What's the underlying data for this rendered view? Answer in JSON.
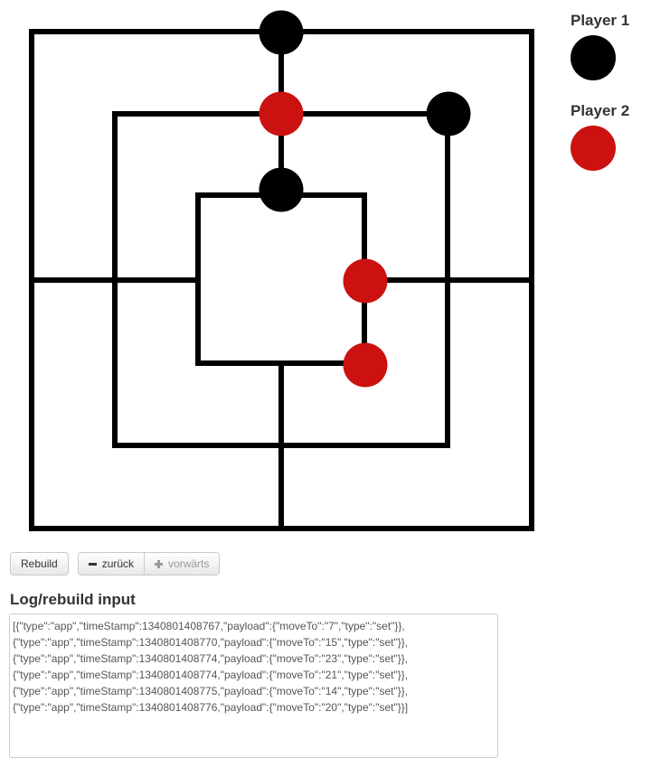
{
  "legend": {
    "player1": {
      "label": "Player 1",
      "color": "#000000"
    },
    "player2": {
      "label": "Player 2",
      "color": "#cc1111"
    }
  },
  "board": {
    "line_color": "#000000",
    "pieces": [
      {
        "owner": "player1",
        "point": "outer-top-center"
      },
      {
        "owner": "player2",
        "point": "middle-top-center"
      },
      {
        "owner": "player1",
        "point": "middle-top-right"
      },
      {
        "owner": "player1",
        "point": "inner-top-center"
      },
      {
        "owner": "player2",
        "point": "inner-middle-right"
      },
      {
        "owner": "player2",
        "point": "inner-bottom-right"
      }
    ]
  },
  "toolbar": {
    "rebuild_label": "Rebuild",
    "back_label": "zurück",
    "forward_label": "vorwärts"
  },
  "log": {
    "title": "Log/rebuild input",
    "content": "[{\"type\":\"app\",\"timeStamp\":1340801408767,\"payload\":{\"moveTo\":\"7\",\"type\":\"set\"}},\n{\"type\":\"app\",\"timeStamp\":1340801408770,\"payload\":{\"moveTo\":\"15\",\"type\":\"set\"}},\n{\"type\":\"app\",\"timeStamp\":1340801408774,\"payload\":{\"moveTo\":\"23\",\"type\":\"set\"}},\n{\"type\":\"app\",\"timeStamp\":1340801408774,\"payload\":{\"moveTo\":\"21\",\"type\":\"set\"}},\n{\"type\":\"app\",\"timeStamp\":1340801408775,\"payload\":{\"moveTo\":\"14\",\"type\":\"set\"}},\n{\"type\":\"app\",\"timeStamp\":1340801408776,\"payload\":{\"moveTo\":\"20\",\"type\":\"set\"}}]"
  }
}
